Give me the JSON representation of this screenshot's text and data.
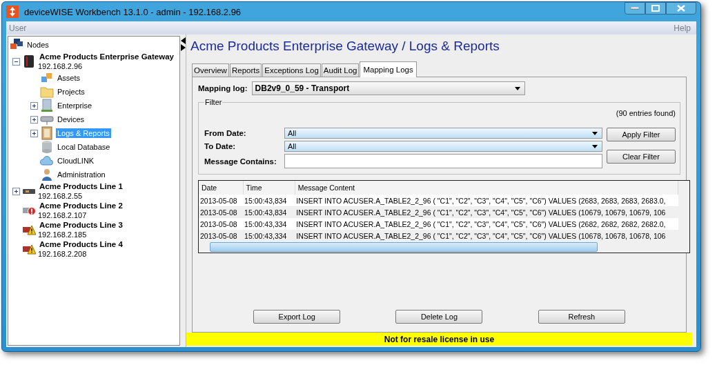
{
  "window": {
    "title": "deviceWISE Workbench 13.1.0  -  admin  -  192.168.2.96"
  },
  "menu": [
    "User",
    "Help"
  ],
  "tree": {
    "label": "Nodes",
    "kind": "nodes",
    "children": [
      {
        "label": "Acme Products Enterprise Gateway",
        "sub": "192.168.2.96",
        "kind": "server",
        "expanded": true,
        "selected": false,
        "children": [
          {
            "label": "Assets",
            "kind": "cubes",
            "selected": false
          },
          {
            "label": "Projects",
            "kind": "folder",
            "selected": false
          },
          {
            "label": "Enterprise",
            "kind": "building",
            "expanded": false,
            "selected": false
          },
          {
            "label": "Devices",
            "kind": "device",
            "expanded": false,
            "selected": false
          },
          {
            "label": "Logs & Reports",
            "kind": "book",
            "expanded": false,
            "selected": true
          },
          {
            "label": "Local Database",
            "kind": "database",
            "selected": false
          },
          {
            "label": "CloudLINK",
            "kind": "cloud",
            "selected": false
          },
          {
            "label": "Administration",
            "kind": "user",
            "selected": false
          }
        ]
      },
      {
        "label": "Acme Products Line 1",
        "sub": "192.168.2.55",
        "kind": "gateway",
        "expanded": false,
        "selected": false
      },
      {
        "label": "Acme Products Line 2",
        "sub": "192.168.2.107",
        "kind": "gateway-error",
        "selected": false
      },
      {
        "label": "Acme Products Line 3",
        "sub": "192.168.2.185",
        "kind": "gateway-warning",
        "selected": false
      },
      {
        "label": "Acme Products Line 4",
        "sub": "192.168.2.208",
        "kind": "gateway-warning",
        "selected": false
      }
    ]
  },
  "heading": "Acme Products Enterprise Gateway / Logs & Reports",
  "tabs": [
    {
      "label": "Overview",
      "selected": false
    },
    {
      "label": "Reports",
      "selected": false
    },
    {
      "label": "Exceptions Log",
      "selected": false
    },
    {
      "label": "Audit Log",
      "selected": false
    },
    {
      "label": "Mapping Logs",
      "selected": true
    }
  ],
  "mapping_log": {
    "label": "Mapping log:",
    "value": "DB2v9_0_59 - Transport"
  },
  "filter": {
    "title": "Filter",
    "count": "(90 entries found)",
    "from_label": "From Date:",
    "from_value": "All",
    "to_label": "To Date:",
    "to_value": "All",
    "message_label": "Message Contains:",
    "buttons": [
      "Apply Filter",
      "Clear Filter"
    ]
  },
  "table": {
    "columns": [
      "Date",
      "Time",
      "Message Content"
    ],
    "rows": [
      [
        "2013-05-08",
        "15:00:43,834",
        "INSERT INTO ACUSER.A_TABLE2_2_96 ( \"C1\", \"C2\", \"C3\", \"C4\", \"C5\", \"C6\") VALUES (2683, 2683, 2683, 2683.0,"
      ],
      [
        "2013-05-08",
        "15:00:43,834",
        "INSERT INTO ACUSER.A_TABLE2_2_96 ( \"C1\", \"C2\", \"C3\", \"C4\", \"C5\", \"C6\") VALUES (10679, 10679, 10679, 106"
      ],
      [
        "2013-05-08",
        "15:00:43,334",
        "INSERT INTO ACUSER.A_TABLE2_2_96 ( \"C1\", \"C2\", \"C3\", \"C4\", \"C5\", \"C6\") VALUES (2682, 2682, 2682, 2682.0,"
      ],
      [
        "2013-05-08",
        "15:00:43,334",
        "INSERT INTO ACUSER.A_TABLE2_2_96 ( \"C1\", \"C2\", \"C3\", \"C4\", \"C5\", \"C6\") VALUES (10678, 10678, 10678, 106"
      ]
    ]
  },
  "buttons": [
    "Export Log",
    "Delete Log",
    "Refresh"
  ],
  "status_bar": "Not for resale license in use"
}
